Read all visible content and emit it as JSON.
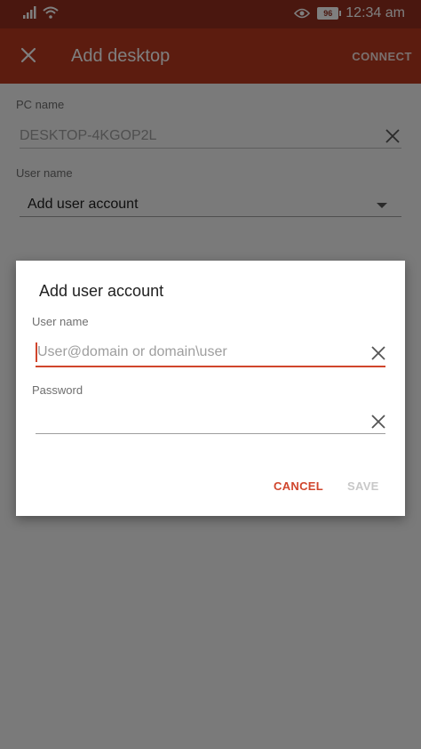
{
  "status_bar": {
    "battery": "96",
    "time": "12:34 am"
  },
  "app_bar": {
    "title": "Add desktop",
    "connect_label": "CONNECT"
  },
  "form": {
    "pc_name_label": "PC name",
    "pc_name_value": "DESKTOP-4KGOP2L",
    "user_name_label": "User name",
    "user_name_value": "Add user account"
  },
  "dialog": {
    "title": "Add user account",
    "username_label": "User name",
    "username_placeholder": "User@domain or domain\\user",
    "username_value": "",
    "password_label": "Password",
    "password_value": "",
    "cancel_label": "CANCEL",
    "save_label": "SAVE"
  },
  "colors": {
    "accent": "#d0452c",
    "appbar": "#b8391f",
    "statusbar": "#952f1f",
    "disabled_text": "#c8c8c8"
  }
}
